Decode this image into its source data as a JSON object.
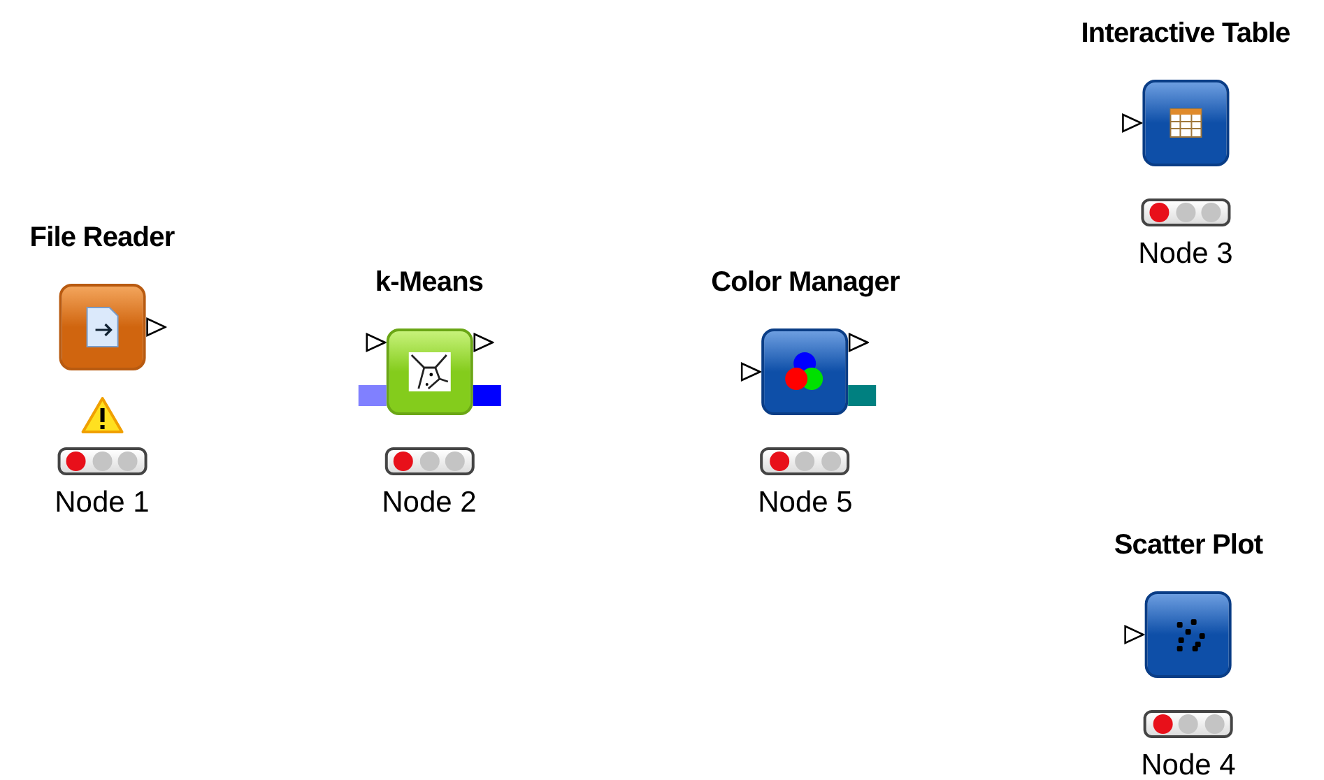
{
  "nodes": [
    {
      "title": "File Reader",
      "label": "Node 1",
      "kind": "reader",
      "warning": true,
      "configured": false,
      "outputs": [
        {
          "kind": "data"
        }
      ]
    },
    {
      "title": "k-Means",
      "label": "Node 2",
      "kind": "kmeans",
      "warning": false,
      "configured": false,
      "inputs": [
        {
          "kind": "data"
        },
        {
          "kind": "model",
          "color": "#8080ff"
        }
      ],
      "outputs": [
        {
          "kind": "data"
        },
        {
          "kind": "model",
          "color": "#0000ff"
        }
      ]
    },
    {
      "title": "Color Manager",
      "label": "Node 5",
      "kind": "color",
      "warning": false,
      "configured": false,
      "inputs": [
        {
          "kind": "data"
        }
      ],
      "outputs": [
        {
          "kind": "data"
        },
        {
          "kind": "model",
          "color": "#008080"
        }
      ]
    },
    {
      "title": "Interactive Table",
      "label": "Node 3",
      "kind": "table",
      "warning": false,
      "configured": false,
      "inputs": [
        {
          "kind": "data"
        }
      ]
    },
    {
      "title": "Scatter Plot",
      "label": "Node 4",
      "kind": "scatter",
      "warning": false,
      "configured": false,
      "inputs": [
        {
          "kind": "data"
        }
      ]
    }
  ]
}
